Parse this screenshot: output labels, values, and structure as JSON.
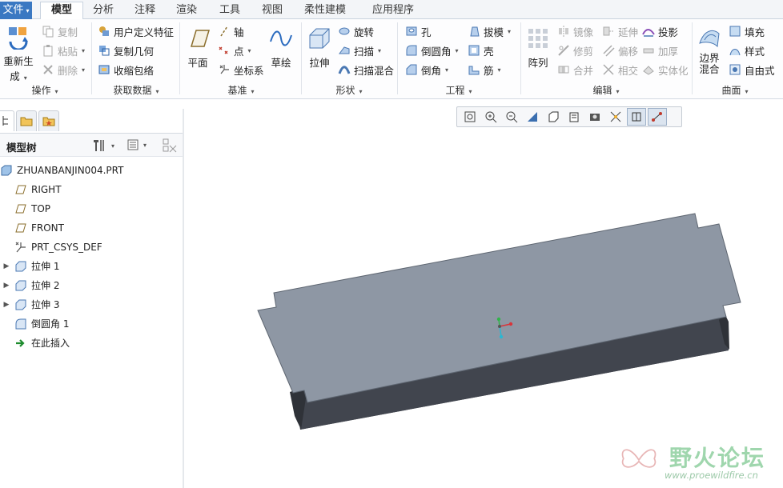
{
  "tabs": [
    "文件",
    "模型",
    "分析",
    "注释",
    "渲染",
    "工具",
    "视图",
    "柔性建模",
    "应用程序"
  ],
  "ribbon": {
    "operations": {
      "regen_label": "重新生成",
      "copy": "复制",
      "paste": "粘贴",
      "delete": "删除",
      "group_label": "操作"
    },
    "get_data": {
      "udf": "用户定义特征",
      "copy_geometry": "复制几何",
      "shrinkwrap": "收缩包络",
      "group_label": "获取数据"
    },
    "datum": {
      "plane": "平面",
      "axis": "轴",
      "point": "点",
      "csys": "坐标系",
      "sketch": "草绘",
      "group_label": "基准"
    },
    "shapes": {
      "extrude": "拉伸",
      "revolve": "旋转",
      "sweep": "扫描",
      "swept_blend": "扫描混合",
      "group_label": "形状"
    },
    "engineering": {
      "hole": "孔",
      "round": "倒圆角",
      "chamfer": "倒角",
      "draft": "拔模",
      "shell": "壳",
      "rib": "筋",
      "group_label": "工程"
    },
    "editing": {
      "pattern": "阵列",
      "mirror": "镜像",
      "trim": "修剪",
      "merge": "合并",
      "extend": "延伸",
      "offset": "偏移",
      "intersect": "相交",
      "project": "投影",
      "thicken": "加厚",
      "solidify": "实体化",
      "group_label": "编辑"
    },
    "surfaces": {
      "boundary_blend": "边界混合",
      "fill": "填充",
      "style": "样式",
      "freestyle": "自由式",
      "group_label": "曲面"
    }
  },
  "navigator": {
    "header_title": "模型树",
    "items": [
      {
        "label": "ZHUANBANJIN004.PRT",
        "icon": "part-icon"
      },
      {
        "label": "RIGHT",
        "icon": "datum-plane-icon"
      },
      {
        "label": "TOP",
        "icon": "datum-plane-icon"
      },
      {
        "label": "FRONT",
        "icon": "datum-plane-icon"
      },
      {
        "label": "PRT_CSYS_DEF",
        "icon": "csys-icon"
      },
      {
        "label": "拉伸 1",
        "icon": "extrude-icon"
      },
      {
        "label": "拉伸 2",
        "icon": "extrude-icon"
      },
      {
        "label": "拉伸 3",
        "icon": "extrude-icon"
      },
      {
        "label": "倒圆角 1",
        "icon": "round-icon"
      },
      {
        "label": "在此插入",
        "icon": "insert-arrow-icon"
      }
    ]
  },
  "view_toolbar": [
    "refit-icon",
    "zoom-in-icon",
    "zoom-out-icon",
    "repaint-icon",
    "display-style-icon",
    "saved-orientations-icon",
    "view-manager-icon",
    "perspective-icon",
    "datum-display-icon",
    "spin-center-icon"
  ],
  "watermark": {
    "title": "野火论坛",
    "url": "www.proewildfire.cn"
  },
  "colors": {
    "file_tab": "#3a78c2",
    "model_top_face": "#8e97a4",
    "model_side_face": "#3c3f47",
    "watermark": "#9fd6ad"
  }
}
